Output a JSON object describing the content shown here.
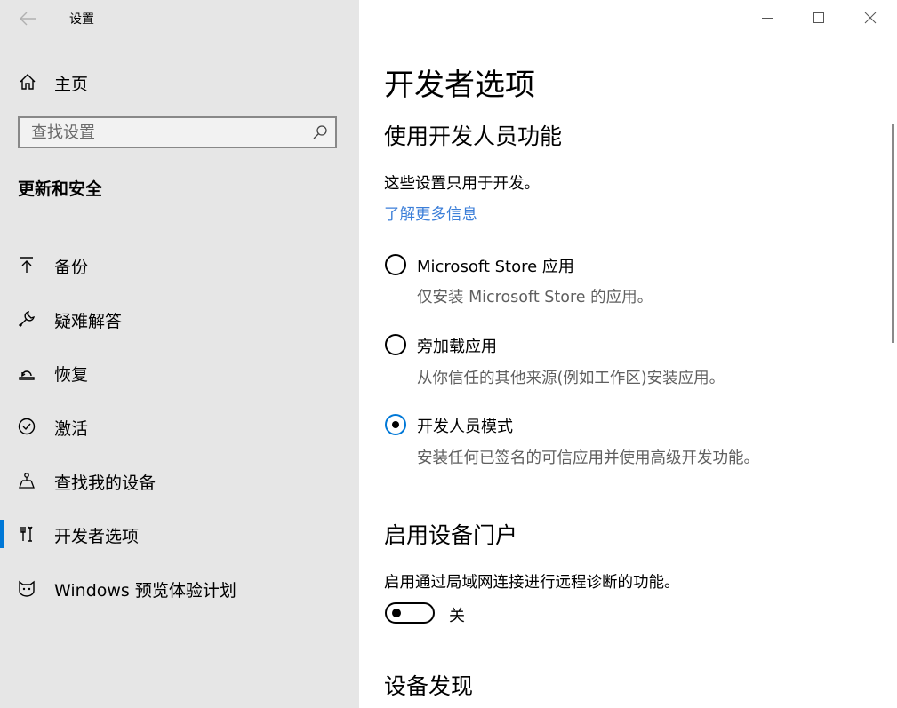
{
  "window": {
    "title": "设置"
  },
  "sidebar": {
    "home_label": "主页",
    "search": {
      "placeholder": "查找设置",
      "value": ""
    },
    "section_title": "更新和安全",
    "items": [
      {
        "label": "备份",
        "icon": "backup-arrow-icon"
      },
      {
        "label": "疑难解答",
        "icon": "wrench-icon"
      },
      {
        "label": "恢复",
        "icon": "recovery-icon"
      },
      {
        "label": "激活",
        "icon": "check-circle-icon"
      },
      {
        "label": "查找我的设备",
        "icon": "find-device-icon"
      },
      {
        "label": "开发者选项",
        "icon": "developer-tools-icon",
        "selected": true
      },
      {
        "label": "Windows 预览体验计划",
        "icon": "insider-cat-icon"
      }
    ]
  },
  "main": {
    "title": "开发者选项",
    "use_dev_features": {
      "heading": "使用开发人员功能",
      "description": "这些设置只用于开发。",
      "link": "了解更多信息",
      "options": [
        {
          "label": "Microsoft Store 应用",
          "description": "仅安装 Microsoft Store 的应用。",
          "checked": false
        },
        {
          "label": "旁加载应用",
          "description": "从你信任的其他来源(例如工作区)安装应用。",
          "checked": false
        },
        {
          "label": "开发人员模式",
          "description": "安装任何已签名的可信应用并使用高级开发功能。",
          "checked": true
        }
      ]
    },
    "device_portal": {
      "heading": "启用设备门户",
      "description": "启用通过局域网连接进行远程诊断的功能。",
      "toggle_label": "关",
      "toggle_on": false
    },
    "device_discovery": {
      "heading": "设备发现"
    }
  },
  "colors": {
    "accent": "#0078d7",
    "link": "#3b7ed8",
    "sidebar_bg": "#e6e6e6"
  }
}
